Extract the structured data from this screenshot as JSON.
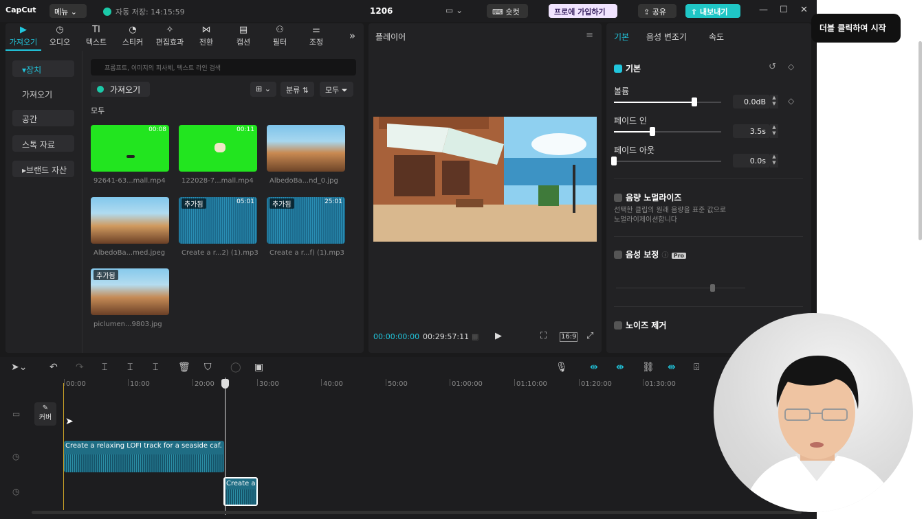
{
  "titlebar": {
    "logo": "CapCut",
    "menu": "메뉴",
    "autosave": "자동 저장: 14:15:59",
    "project_title": "1206",
    "shortcut": "숏컷",
    "pro": "프로에 가입하기",
    "share": "공유",
    "export": "내보내기",
    "minimize": "—",
    "maximize": "☐",
    "close": "✕"
  },
  "left_tabs": [
    {
      "icon": "import-icon",
      "glyph": "▶",
      "label": "가져오기"
    },
    {
      "icon": "audio-icon",
      "glyph": "◷",
      "label": "오디오"
    },
    {
      "icon": "text-icon",
      "glyph": "TI",
      "label": "텍스트"
    },
    {
      "icon": "sticker-icon",
      "glyph": "◔",
      "label": "스티커"
    },
    {
      "icon": "effects-icon",
      "glyph": "✧",
      "label": "편집효과"
    },
    {
      "icon": "transition-icon",
      "glyph": "⋈",
      "label": "전환"
    },
    {
      "icon": "caption-icon",
      "glyph": "▤",
      "label": "캡션"
    },
    {
      "icon": "filter-icon",
      "glyph": "⚇",
      "label": "필터"
    },
    {
      "icon": "adjust-icon",
      "glyph": "⚌",
      "label": "조정"
    }
  ],
  "more_tabs": "»",
  "sidebar": {
    "items": [
      "장치",
      "가져오기",
      "공간",
      "스톡 자료",
      "브랜드 자산"
    ]
  },
  "media": {
    "search_placeholder": "프롬프트, 이미지의 피사체, 텍스트 라인 검색",
    "import_label": "가져오기",
    "view_label": "⊞ ⌄",
    "sort_label": "분류 ⇅",
    "filter_label": "모두 ⏷",
    "section_label": "모두",
    "added_badge": "추가됨",
    "items": [
      {
        "name": "92641-63...mall.mp4",
        "duration": "00:08",
        "kind": "green"
      },
      {
        "name": "122028-7...mall.mp4",
        "duration": "00:11",
        "kind": "green"
      },
      {
        "name": "AlbedoBa...nd_0.jpg",
        "duration": "",
        "kind": "image"
      },
      {
        "name": "AlbedoBa...med.jpeg",
        "duration": "",
        "kind": "image"
      },
      {
        "name": "Create a r...2) (1).mp3",
        "duration": "05:01",
        "kind": "audio"
      },
      {
        "name": "Create a r...f) (1).mp3",
        "duration": "25:01",
        "kind": "audio"
      },
      {
        "name": "piclumen...9803.jpg",
        "duration": "",
        "kind": "image"
      }
    ]
  },
  "player": {
    "title": "플레이어",
    "menu": "≡",
    "current_time": "00:00:00:00",
    "total_time": "00:29:57:11",
    "ratio": "16:9"
  },
  "right_panel": {
    "tabs": [
      "기본",
      "음성 변조기",
      "속도"
    ],
    "basic_header": "기본",
    "volume": {
      "label": "볼륨",
      "value": "0.0dB",
      "level": 0.75
    },
    "fade_in": {
      "label": "페이드 인",
      "value": "3.5s",
      "level": 0.36
    },
    "fade_out": {
      "label": "페이드 아웃",
      "value": "0.0s",
      "level": 0.0
    },
    "normalize": {
      "label": "음량 노멀라이즈",
      "desc_line1": "선택한 클립의 원래 음량을 표준 값으로",
      "desc_line2": "노멀라이제이션합니다"
    },
    "voice_enhance": {
      "label": "음성 보정",
      "badge": "Pro"
    },
    "noise": {
      "label": "노이즈 제거"
    }
  },
  "timeline": {
    "ruler": [
      "00:00",
      "10:00",
      "20:00",
      "30:00",
      "40:00",
      "50:00",
      "01:00:00",
      "01:10:00",
      "01:20:00",
      "01:30:00"
    ],
    "cover_label": "커버",
    "clip1_label": "Create a relaxing LOFI track for a seaside caf. U",
    "clip2_label": "Create a"
  },
  "tooltip": "더블 클릭하여 시작",
  "colors": {
    "accent": "#21c6dd",
    "green_screen": "#22e51f",
    "audio_clip": "#1f6d84"
  }
}
